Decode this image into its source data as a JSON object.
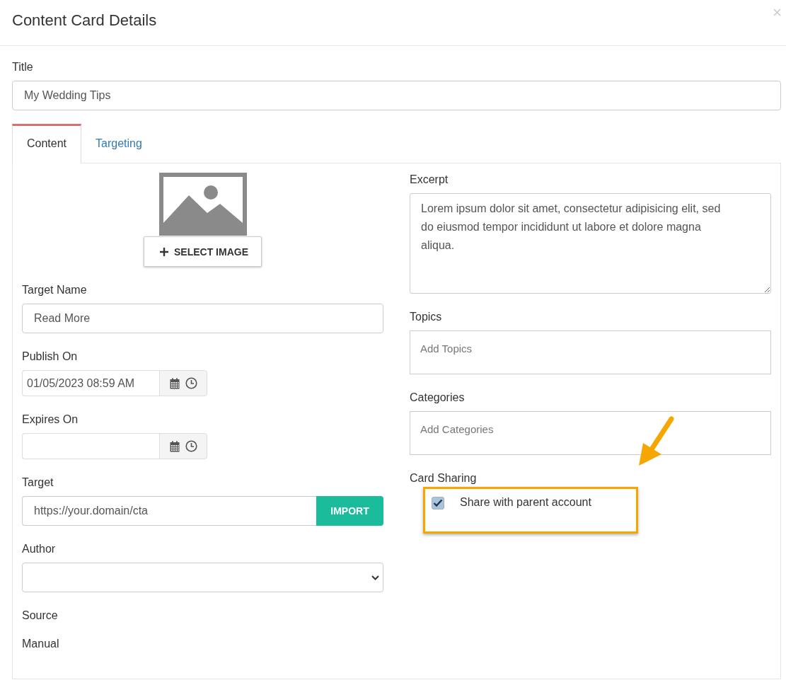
{
  "window": {
    "title": "Content Card Details"
  },
  "title_field": {
    "label": "Title",
    "value": "My Wedding Tips"
  },
  "tabs": [
    {
      "label": "Content",
      "selected": true
    },
    {
      "label": "Targeting",
      "selected": false
    }
  ],
  "image": {
    "button": "SELECT IMAGE"
  },
  "target_name": {
    "label": "Target Name",
    "value": "Read More"
  },
  "publish_on": {
    "label": "Publish On",
    "value": "01/05/2023 08:59 AM"
  },
  "expires_on": {
    "label": "Expires On"
  },
  "target": {
    "label": "Target",
    "value": "https://your.domain/cta",
    "button": "IMPORT"
  },
  "author": {
    "label": "Author"
  },
  "source": {
    "label": "Source",
    "value": "Manual"
  },
  "excerpt": {
    "label": "Excerpt",
    "value": "Lorem ipsum dolor sit amet, consectetur adipisicing elit, sed do eiusmod tempor incididunt ut labore et dolore magna aliqua."
  },
  "topics": {
    "label": "Topics",
    "placeholder": "Add Topics"
  },
  "categories": {
    "label": "Categories",
    "placeholder": "Add Categories"
  },
  "card_sharing": {
    "label": "Card Sharing",
    "option": "Share with parent account",
    "checked": true
  }
}
